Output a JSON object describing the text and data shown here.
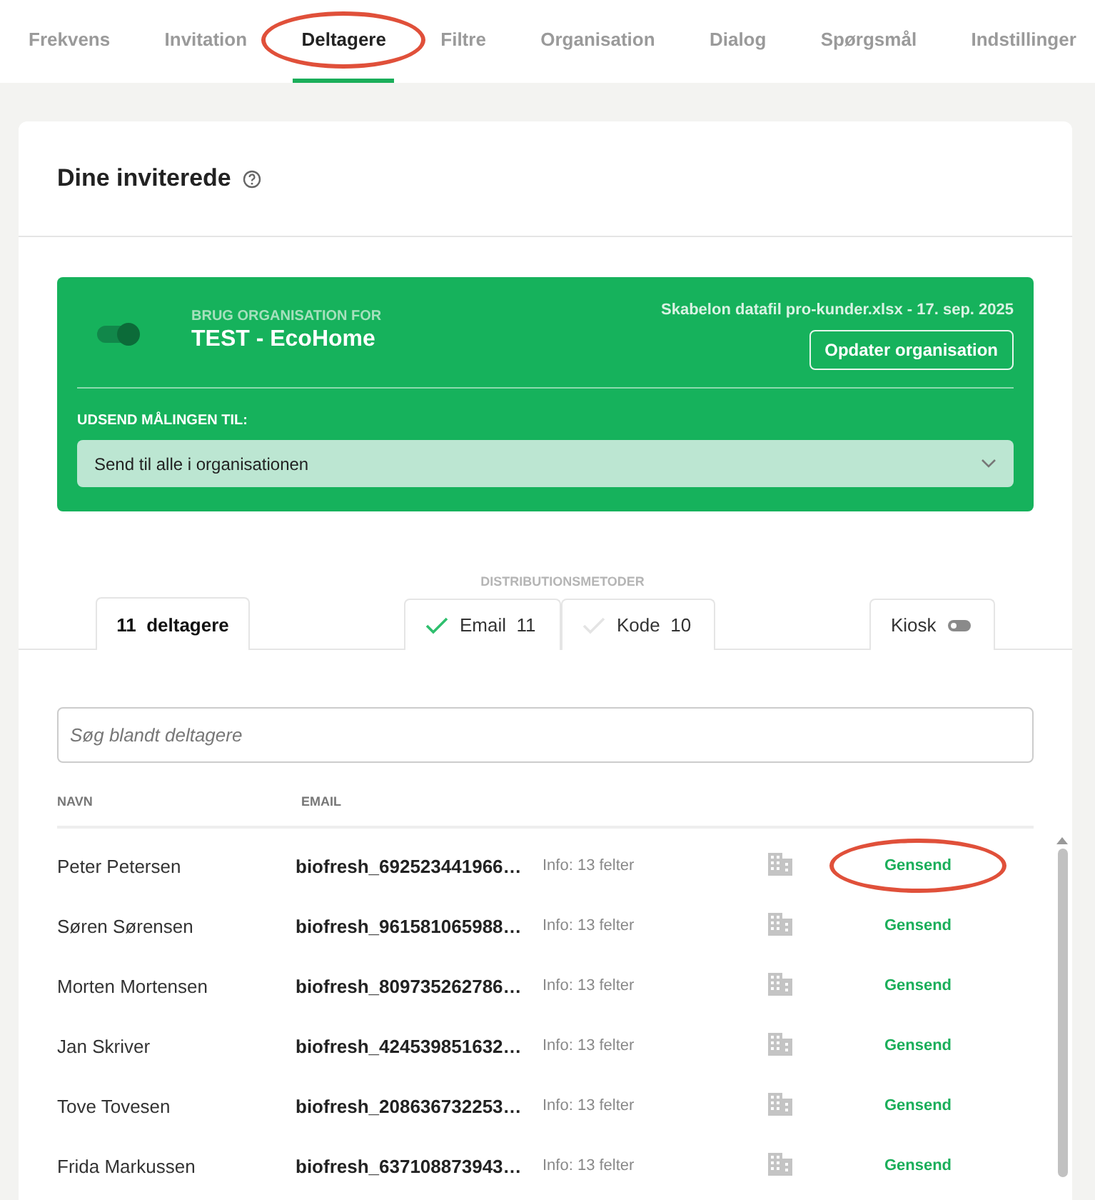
{
  "tabs": [
    {
      "label": "Frekvens",
      "selected": false,
      "circled": false
    },
    {
      "label": "Invitation",
      "selected": false,
      "circled": false
    },
    {
      "label": "Deltagere",
      "selected": true,
      "circled": true
    },
    {
      "label": "Filtre",
      "selected": false,
      "circled": false
    },
    {
      "label": "Organisation",
      "selected": false,
      "circled": false
    },
    {
      "label": "Dialog",
      "selected": false,
      "circled": false
    },
    {
      "label": "Spørgsmål",
      "selected": false,
      "circled": false
    },
    {
      "label": "Indstillinger",
      "selected": false,
      "circled": false
    }
  ],
  "card": {
    "title": "Dine inviterede",
    "organisation": {
      "on": true,
      "label": "BRUG ORGANISATION FOR",
      "name": "TEST - EcoHome",
      "file": "Skabelon datafil pro-kunder.xlsx - 17. sep. 2025",
      "button": "Opdater organisation",
      "send_label": "UDSEND MÅLINGEN TIL:",
      "send_value": "Send til alle i organisationen"
    },
    "distribution_label": "DISTRIBUTIONSMETODER",
    "participants_tab": {
      "count": "11",
      "label": "deltagere"
    },
    "methods": [
      {
        "label": "Email",
        "count": "11",
        "checked": true
      },
      {
        "label": "Kode",
        "count": "10",
        "checked": false
      }
    ],
    "kiosk": {
      "label": "Kiosk",
      "on": false
    },
    "search": {
      "placeholder": "Søg blandt deltagere"
    },
    "columns": [
      "NAVN",
      "EMAIL"
    ],
    "rows": [
      {
        "name": "Peter Petersen",
        "email": "biofresh_692523441966…",
        "info": "Info: 13 felter",
        "action": "Gensend",
        "circled": true
      },
      {
        "name": "Søren Sørensen",
        "email": "biofresh_961581065988…",
        "info": "Info: 13 felter",
        "action": "Gensend",
        "circled": false
      },
      {
        "name": "Morten Mortensen",
        "email": "biofresh_809735262786…",
        "info": "Info: 13 felter",
        "action": "Gensend",
        "circled": false
      },
      {
        "name": "Jan Skriver",
        "email": "biofresh_424539851632…",
        "info": "Info: 13 felter",
        "action": "Gensend",
        "circled": false
      },
      {
        "name": "Tove Tovesen",
        "email": "biofresh_208636732253…",
        "info": "Info: 13 felter",
        "action": "Gensend",
        "circled": false
      },
      {
        "name": "Frida Markussen",
        "email": "biofresh_637108873943…",
        "info": "Info: 13 felter",
        "action": "Gensend",
        "circled": false
      }
    ]
  }
}
